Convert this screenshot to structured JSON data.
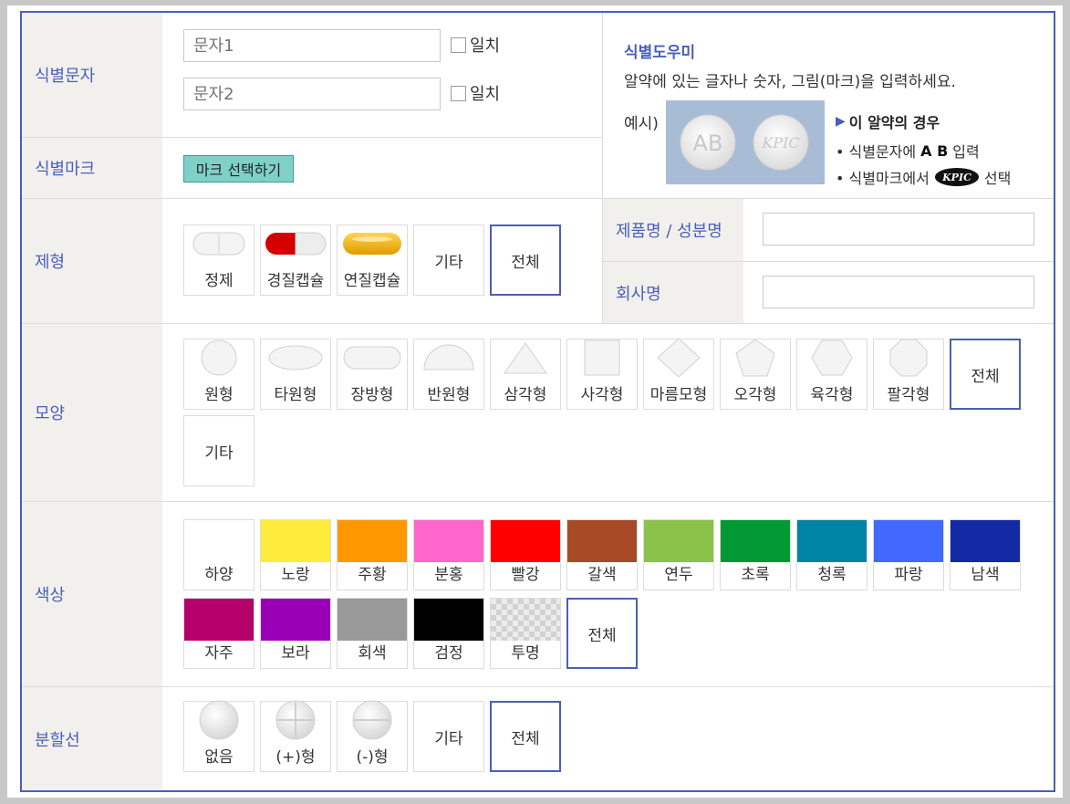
{
  "labels": {
    "identifier_text": "식별문자",
    "identifier_mark": "식별마크",
    "form": "제형",
    "shape": "모양",
    "color": "색상",
    "score_line": "분할선",
    "product_name": "제품명 / 성분명",
    "company_name": "회사명"
  },
  "text_inputs": {
    "text1_placeholder": "문자1",
    "text2_placeholder": "문자2",
    "match_label": "일치"
  },
  "mark_button": "마크 선택하기",
  "helper": {
    "title": "식별도우미",
    "desc": "알약에 있는 글자나 숫자, 그림(마크)을 입력하세요.",
    "example_label": "예시)",
    "pill_text": "AB",
    "pill_mark": "KPIC",
    "case_title": "이 알약의 경우",
    "line1_prefix": "• 식별문자에",
    "line1_bold": "A B",
    "line1_suffix": "입력",
    "line2_prefix": "• 식별마크에서",
    "line2_suffix": "선택"
  },
  "forms": [
    "정제",
    "경질캡슐",
    "연질캡슐",
    "기타",
    "전체"
  ],
  "shapes": [
    "원형",
    "타원형",
    "장방형",
    "반원형",
    "삼각형",
    "사각형",
    "마름모형",
    "오각형",
    "육각형",
    "팔각형",
    "전체",
    "기타"
  ],
  "colors": [
    {
      "name": "하양",
      "hex": "#ffffff"
    },
    {
      "name": "노랑",
      "hex": "#ffeb3b"
    },
    {
      "name": "주황",
      "hex": "#ff9800"
    },
    {
      "name": "분홍",
      "hex": "#ff66cc"
    },
    {
      "name": "빨강",
      "hex": "#ff0000"
    },
    {
      "name": "갈색",
      "hex": "#a64b26"
    },
    {
      "name": "연두",
      "hex": "#8bc34a"
    },
    {
      "name": "초록",
      "hex": "#009933"
    },
    {
      "name": "청록",
      "hex": "#0084a5"
    },
    {
      "name": "파랑",
      "hex": "#4169ff"
    },
    {
      "name": "남색",
      "hex": "#1429a6"
    },
    {
      "name": "자주",
      "hex": "#b5006b"
    },
    {
      "name": "보라",
      "hex": "#9900b5"
    },
    {
      "name": "회색",
      "hex": "#999999"
    },
    {
      "name": "검정",
      "hex": "#000000"
    },
    {
      "name": "투명",
      "hex": "transparent"
    }
  ],
  "color_all": "전체",
  "score_lines": [
    "없음",
    "(+)형",
    "(-)형",
    "기타",
    "전체"
  ],
  "accent_color": "#4a5fb8",
  "selected_border_color": "#4a5fb8"
}
